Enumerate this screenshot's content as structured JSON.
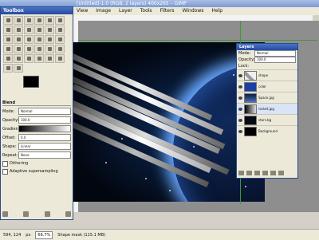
{
  "window": {
    "title": "[Untitled]-1.0 (RGB, 2 layers) 400x265 – GIMP"
  },
  "menu": [
    "View",
    "Image",
    "Layer",
    "Tools",
    "Filters",
    "Windows",
    "Help"
  ],
  "toolbox": {
    "title": "Toolbox",
    "options": {
      "heading": "Blend",
      "mode_label": "Mode:",
      "mode_value": "Normal",
      "opacity_label": "Opacity:",
      "opacity_value": "100.0",
      "gradient_label": "Gradient:",
      "offset_label": "Offset:",
      "offset_value": "0.0",
      "shape_label": "Shape:",
      "shape_value": "Linear",
      "repeat_label": "Repeat:",
      "repeat_value": "None",
      "dithering": "Dithering",
      "adaptive": "Adaptive supersampling"
    }
  },
  "layers": {
    "title": "Layers",
    "mode_label": "Mode:",
    "mode_value": "Normal",
    "opacity_label": "Opacity:",
    "opacity_value": "100.0",
    "lock_label": "Lock:",
    "items": [
      {
        "name": "shape",
        "selected": false
      },
      {
        "name": "color",
        "selected": false
      },
      {
        "name": "Space.jpg",
        "selected": false
      },
      {
        "name": "rocket.jpg",
        "selected": true
      },
      {
        "name": "stars.bg",
        "selected": false
      },
      {
        "name": "Background",
        "selected": false
      }
    ]
  },
  "status": {
    "coords": "594, 124",
    "unit": "px",
    "zoom": "66.7%",
    "message": "Shape mask (115.1 MB)"
  },
  "colors": {
    "fg": "#000000",
    "bg": "#ffffff",
    "accent": "#244aa0"
  }
}
